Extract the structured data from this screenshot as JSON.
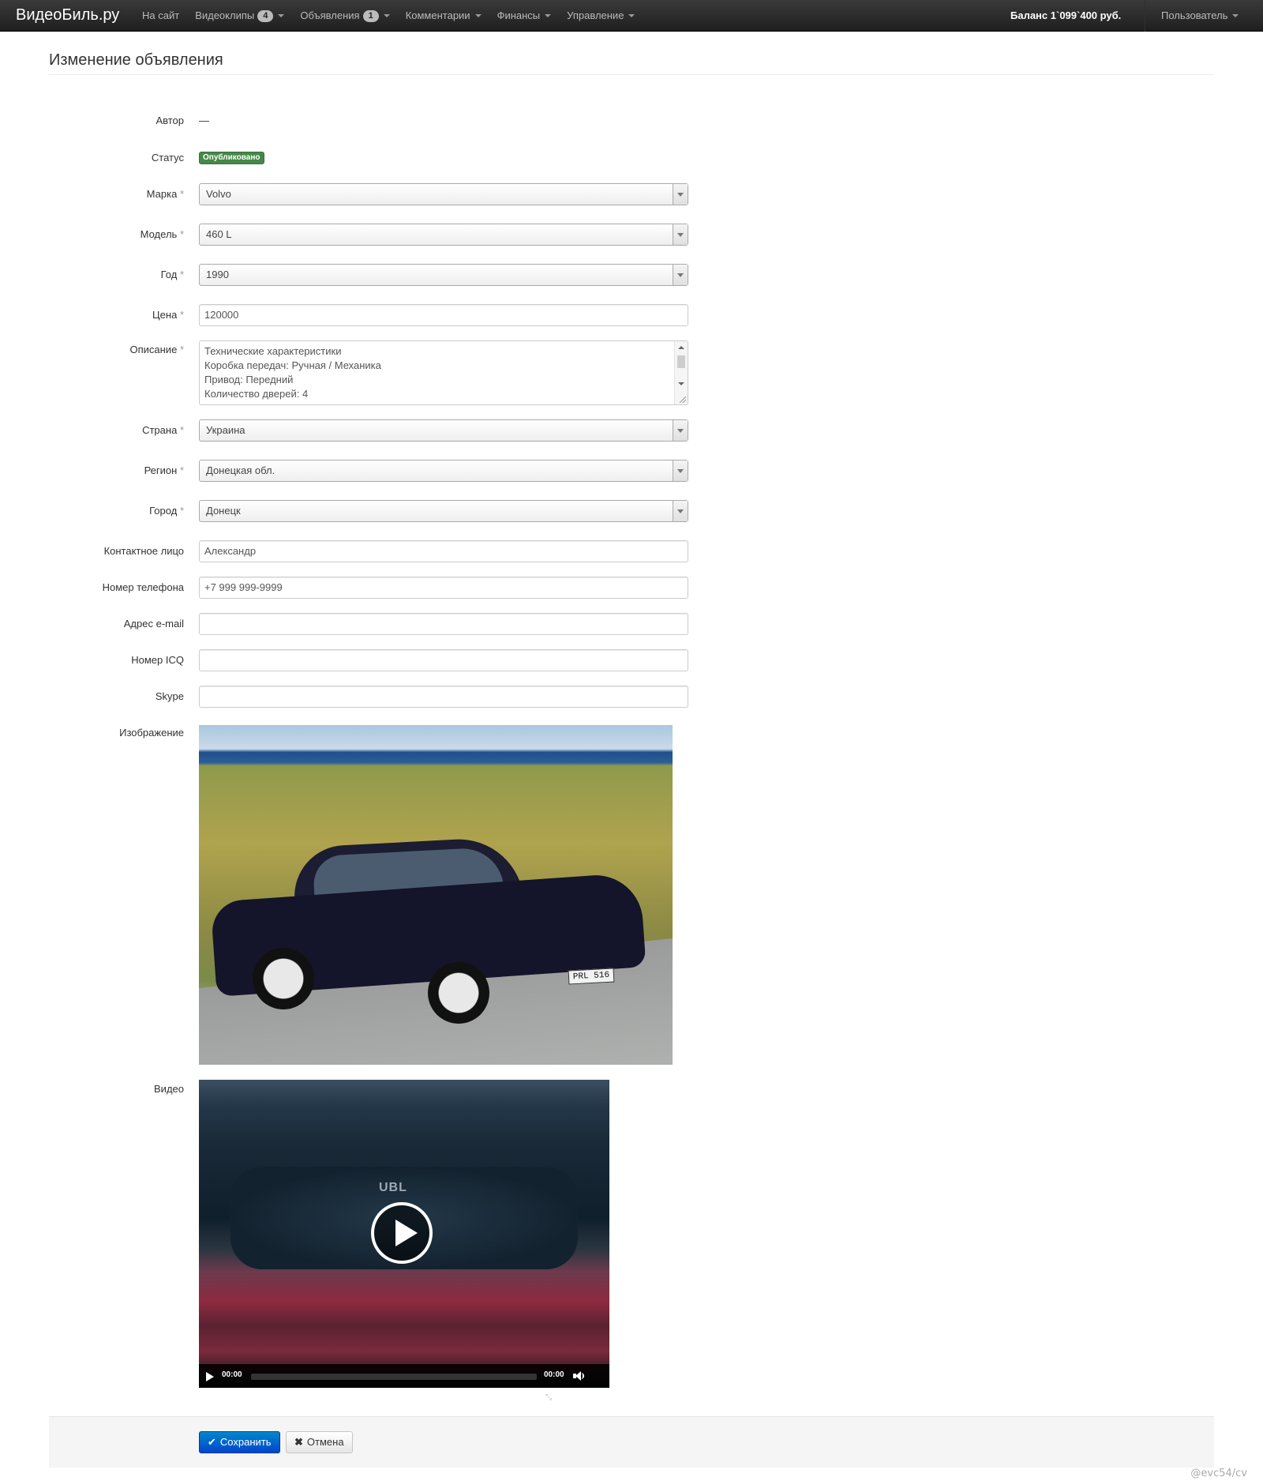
{
  "navbar": {
    "brand": "ВидеоБиль.ру",
    "items": [
      {
        "label": "На сайт",
        "badge": null,
        "dropdown": false
      },
      {
        "label": "Видеоклипы",
        "badge": "4",
        "dropdown": true
      },
      {
        "label": "Объявления",
        "badge": "1",
        "dropdown": true
      },
      {
        "label": "Комментарии",
        "badge": null,
        "dropdown": true
      },
      {
        "label": "Финансы",
        "badge": null,
        "dropdown": true
      },
      {
        "label": "Управление",
        "badge": null,
        "dropdown": true
      }
    ],
    "balance": "Баланс 1`099`400 руб.",
    "user": "Пользователь"
  },
  "page": {
    "title": "Изменение объявления"
  },
  "form": {
    "author": {
      "label": "Автор",
      "value": "—"
    },
    "status": {
      "label": "Статус",
      "value": "Опубликовано",
      "color": "#468847"
    },
    "brand": {
      "label": "Марка",
      "value": "Volvo"
    },
    "model": {
      "label": "Модель",
      "value": "460 L"
    },
    "year": {
      "label": "Год",
      "value": "1990"
    },
    "price": {
      "label": "Цена",
      "value": "120000"
    },
    "description": {
      "label": "Описание",
      "lines": [
        "Технические характеристики",
        "Коробка передач: Ручная / Механика",
        "Привод: Передний",
        "Количество дверей: 4"
      ]
    },
    "country": {
      "label": "Страна",
      "value": "Украина"
    },
    "region": {
      "label": "Регион",
      "value": "Донецкая обл."
    },
    "city": {
      "label": "Город",
      "value": "Донецк"
    },
    "contact": {
      "label": "Контактное лицо",
      "value": "Александр"
    },
    "phone": {
      "label": "Номер телефона",
      "value": "+7 999 999-9999"
    },
    "email": {
      "label": "Адрес e-mail",
      "value": ""
    },
    "icq": {
      "label": "Номер ICQ",
      "value": ""
    },
    "skype": {
      "label": "Skype",
      "value": ""
    },
    "image": {
      "label": "Изображение",
      "plate": "PRL 516"
    },
    "video": {
      "label": "Видео",
      "overlay_text": "UBL",
      "time_current": "00:00",
      "time_total": "00:00"
    },
    "required_mark": "*"
  },
  "actions": {
    "save": "Сохранить",
    "cancel": "Отмена"
  },
  "watermark": "@evc54/cv",
  "colors": {
    "primary": "#0088cc",
    "success": "#468847",
    "navbar": "#222222"
  }
}
